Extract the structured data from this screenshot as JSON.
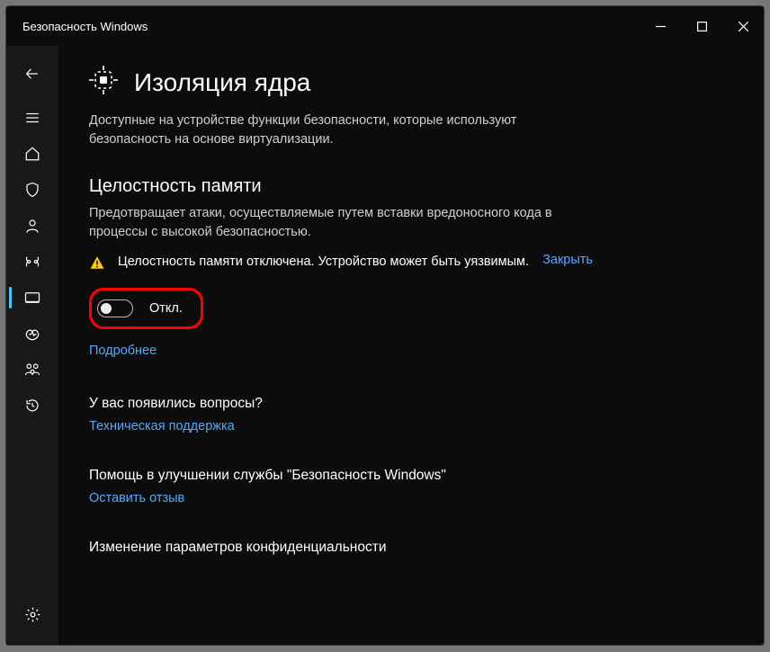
{
  "window": {
    "title": "Безопасность Windows"
  },
  "sidebar": {
    "items": [
      {
        "name": "menu"
      },
      {
        "name": "home"
      },
      {
        "name": "shield"
      },
      {
        "name": "account"
      },
      {
        "name": "firewall"
      },
      {
        "name": "device-security"
      },
      {
        "name": "performance"
      },
      {
        "name": "family"
      },
      {
        "name": "history"
      }
    ]
  },
  "page": {
    "title": "Изоляция ядра",
    "desc": "Доступные на устройстве функции безопасности, которые используют безопасность на основе виртуализации."
  },
  "memory": {
    "title": "Целостность памяти",
    "desc": "Предотвращает атаки, осуществляемые путем вставки вредоносного кода в процессы с высокой безопасностью.",
    "alert": "Целостность памяти отключена. Устройство может быть уязвимым.",
    "alert_close": "Закрыть",
    "toggle_label": "Откл.",
    "more_link": "Подробнее"
  },
  "questions": {
    "title": "У вас появились вопросы?",
    "link": "Техническая поддержка"
  },
  "feedback": {
    "title": "Помощь в улучшении службы \"Безопасность Windows\"",
    "link": "Оставить отзыв"
  },
  "privacy": {
    "title": "Изменение параметров конфиденциальности"
  }
}
